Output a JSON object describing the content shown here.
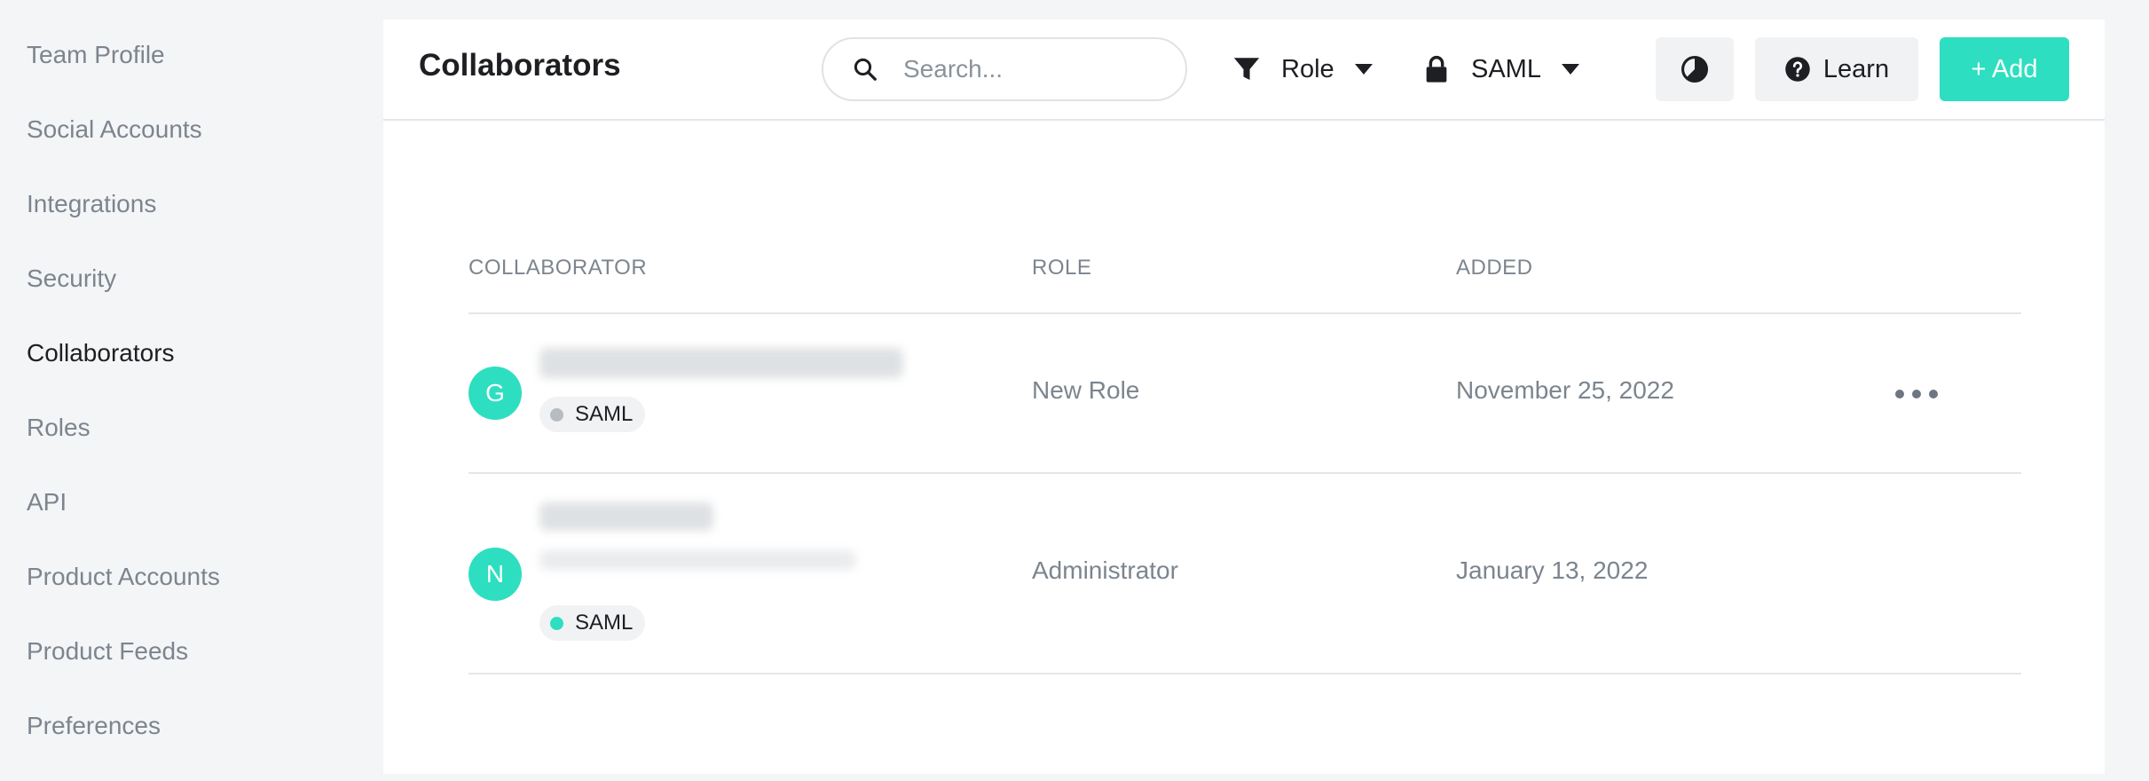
{
  "sidebar": {
    "items": [
      {
        "label": "Team Profile"
      },
      {
        "label": "Social Accounts"
      },
      {
        "label": "Integrations"
      },
      {
        "label": "Security"
      },
      {
        "label": "Collaborators",
        "active": true
      },
      {
        "label": "Roles"
      },
      {
        "label": "API"
      },
      {
        "label": "Product Accounts"
      },
      {
        "label": "Product Feeds"
      },
      {
        "label": "Preferences"
      }
    ]
  },
  "header": {
    "title": "Collaborators",
    "search": {
      "placeholder": "Search...",
      "value": ""
    },
    "filters": {
      "role_label": "Role",
      "saml_label": "SAML"
    },
    "buttons": {
      "learn_label": "Learn",
      "add_label": "+ Add"
    }
  },
  "table": {
    "columns": [
      "COLLABORATOR",
      "ROLE",
      "ADDED"
    ],
    "rows": [
      {
        "initial": "G",
        "badge": "SAML",
        "badge_status_color": "#b7bcc1",
        "role": "New Role",
        "added": "November 25, 2022"
      },
      {
        "initial": "N",
        "badge": "SAML",
        "badge_status_color": "#2ddfc0",
        "role": "Administrator",
        "added": "January 13, 2022"
      }
    ]
  },
  "colors": {
    "accent": "#2ddfc0",
    "text_primary": "#1d1f23",
    "text_muted": "#7c858e",
    "background": "#f4f5f7",
    "divider": "#e3e6ea"
  },
  "icons": {
    "search": "search-icon",
    "filter": "filter-icon",
    "lock": "lock-icon",
    "caret": "caret-down-icon",
    "chart": "pie-chart-icon",
    "help": "question-circle-icon",
    "more": "more-horizontal-icon"
  }
}
